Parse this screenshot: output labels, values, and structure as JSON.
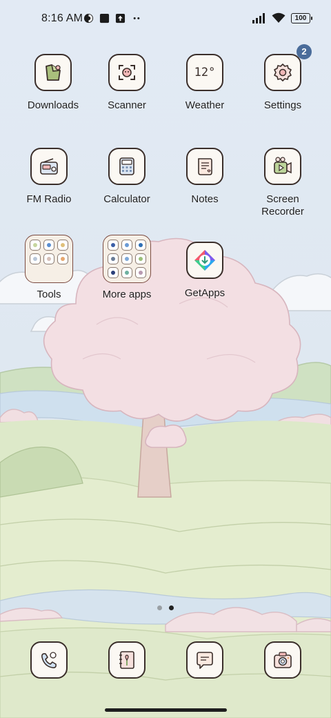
{
  "status_bar": {
    "time": "8:16 AM",
    "battery": "100",
    "left_icons": [
      "data-saver-icon",
      "stop-icon",
      "upload-icon",
      "more-dots-icon"
    ],
    "right_icons": [
      "signal-icon",
      "wifi-icon",
      "battery-icon"
    ]
  },
  "apps": {
    "row1": [
      {
        "label": "Downloads",
        "icon": "download-folder-icon"
      },
      {
        "label": "Scanner",
        "icon": "scanner-icon"
      },
      {
        "label": "Weather",
        "icon": "weather-icon",
        "icon_text": "12°"
      },
      {
        "label": "Settings",
        "icon": "gear-icon",
        "badge": "2"
      }
    ],
    "row2": [
      {
        "label": "FM Radio",
        "icon": "radio-icon"
      },
      {
        "label": "Calculator",
        "icon": "calculator-icon"
      },
      {
        "label": "Notes",
        "icon": "notes-icon"
      },
      {
        "label": "Screen\nRecorder",
        "icon": "video-recorder-icon"
      }
    ],
    "row3": [
      {
        "label": "Tools",
        "icon": "folder-icon"
      },
      {
        "label": "More apps",
        "icon": "folder-icon"
      },
      {
        "label": "GetApps",
        "icon": "getapps-icon"
      }
    ]
  },
  "dock": [
    {
      "name": "phone",
      "icon": "phone-icon"
    },
    {
      "name": "contacts",
      "icon": "contacts-icon"
    },
    {
      "name": "messages",
      "icon": "message-icon"
    },
    {
      "name": "camera",
      "icon": "camera-icon"
    }
  ],
  "page_indicator": {
    "pages": 2,
    "active": 2
  },
  "colors": {
    "icon_border": "#3a2e2a",
    "icon_bg": "#fbf8f3",
    "badge": "#4a6c9a"
  }
}
